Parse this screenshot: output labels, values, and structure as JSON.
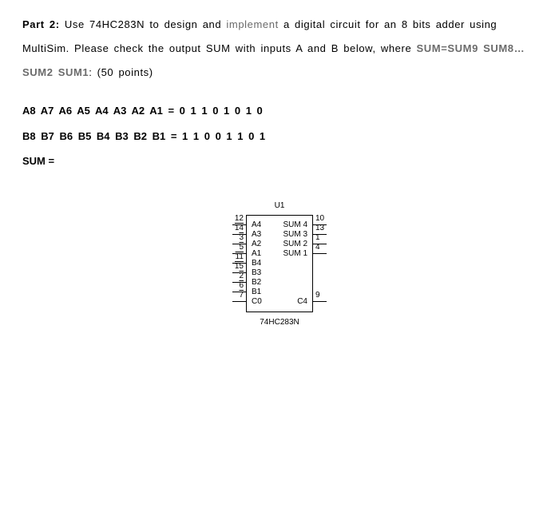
{
  "problem": {
    "part_label": "Part 2:",
    "line1a": " Use 74HC283N to design and ",
    "line1_highlight": "implement",
    "line1b": " a digital circuit for an 8 bits adder using",
    "line2a": "MultiSim. Please check the output SUM with inputs A and B below, where ",
    "line2_gray_bold": "SUM=SUM9 SUM8…",
    "line3_gray_bold": "SUM2 SUM1",
    "line3_rest": ": (50 points)",
    "inputA_label": "A8 A7 A6 A5  A4 A3 A2 A1 = 0 1 1 0  1 0 1 0",
    "inputB_label": "B8 B7 B6 B5  B4 B3 B2 B1 = 1 1 0 0  1 1 0 1",
    "sum_label": "SUM ="
  },
  "chip": {
    "ref": "U1",
    "model": "74HC283N",
    "pins_left": [
      {
        "num": "12",
        "label": "A4",
        "bar": false
      },
      {
        "num": "14",
        "label": "A3",
        "bar": true
      },
      {
        "num": "3",
        "label": "A2",
        "bar": true
      },
      {
        "num": "5",
        "label": "A1",
        "bar": true
      },
      {
        "num": "11",
        "label": "B4",
        "bar": true
      },
      {
        "num": "15",
        "label": "B3",
        "bar": true
      },
      {
        "num": "2",
        "label": "B2",
        "bar": true
      },
      {
        "num": "6",
        "label": "B1",
        "bar": true
      },
      {
        "num": "7",
        "label": "C0",
        "bar": true
      }
    ],
    "pins_right": [
      {
        "num": "10",
        "label": "SUM 4"
      },
      {
        "num": "13",
        "label": "SUM 3"
      },
      {
        "num": "1",
        "label": "SUM 2"
      },
      {
        "num": "4",
        "label": "SUM 1"
      },
      {
        "num": "",
        "label": ""
      },
      {
        "num": "",
        "label": ""
      },
      {
        "num": "",
        "label": ""
      },
      {
        "num": "",
        "label": ""
      },
      {
        "num": "9",
        "label": "C4"
      }
    ]
  }
}
